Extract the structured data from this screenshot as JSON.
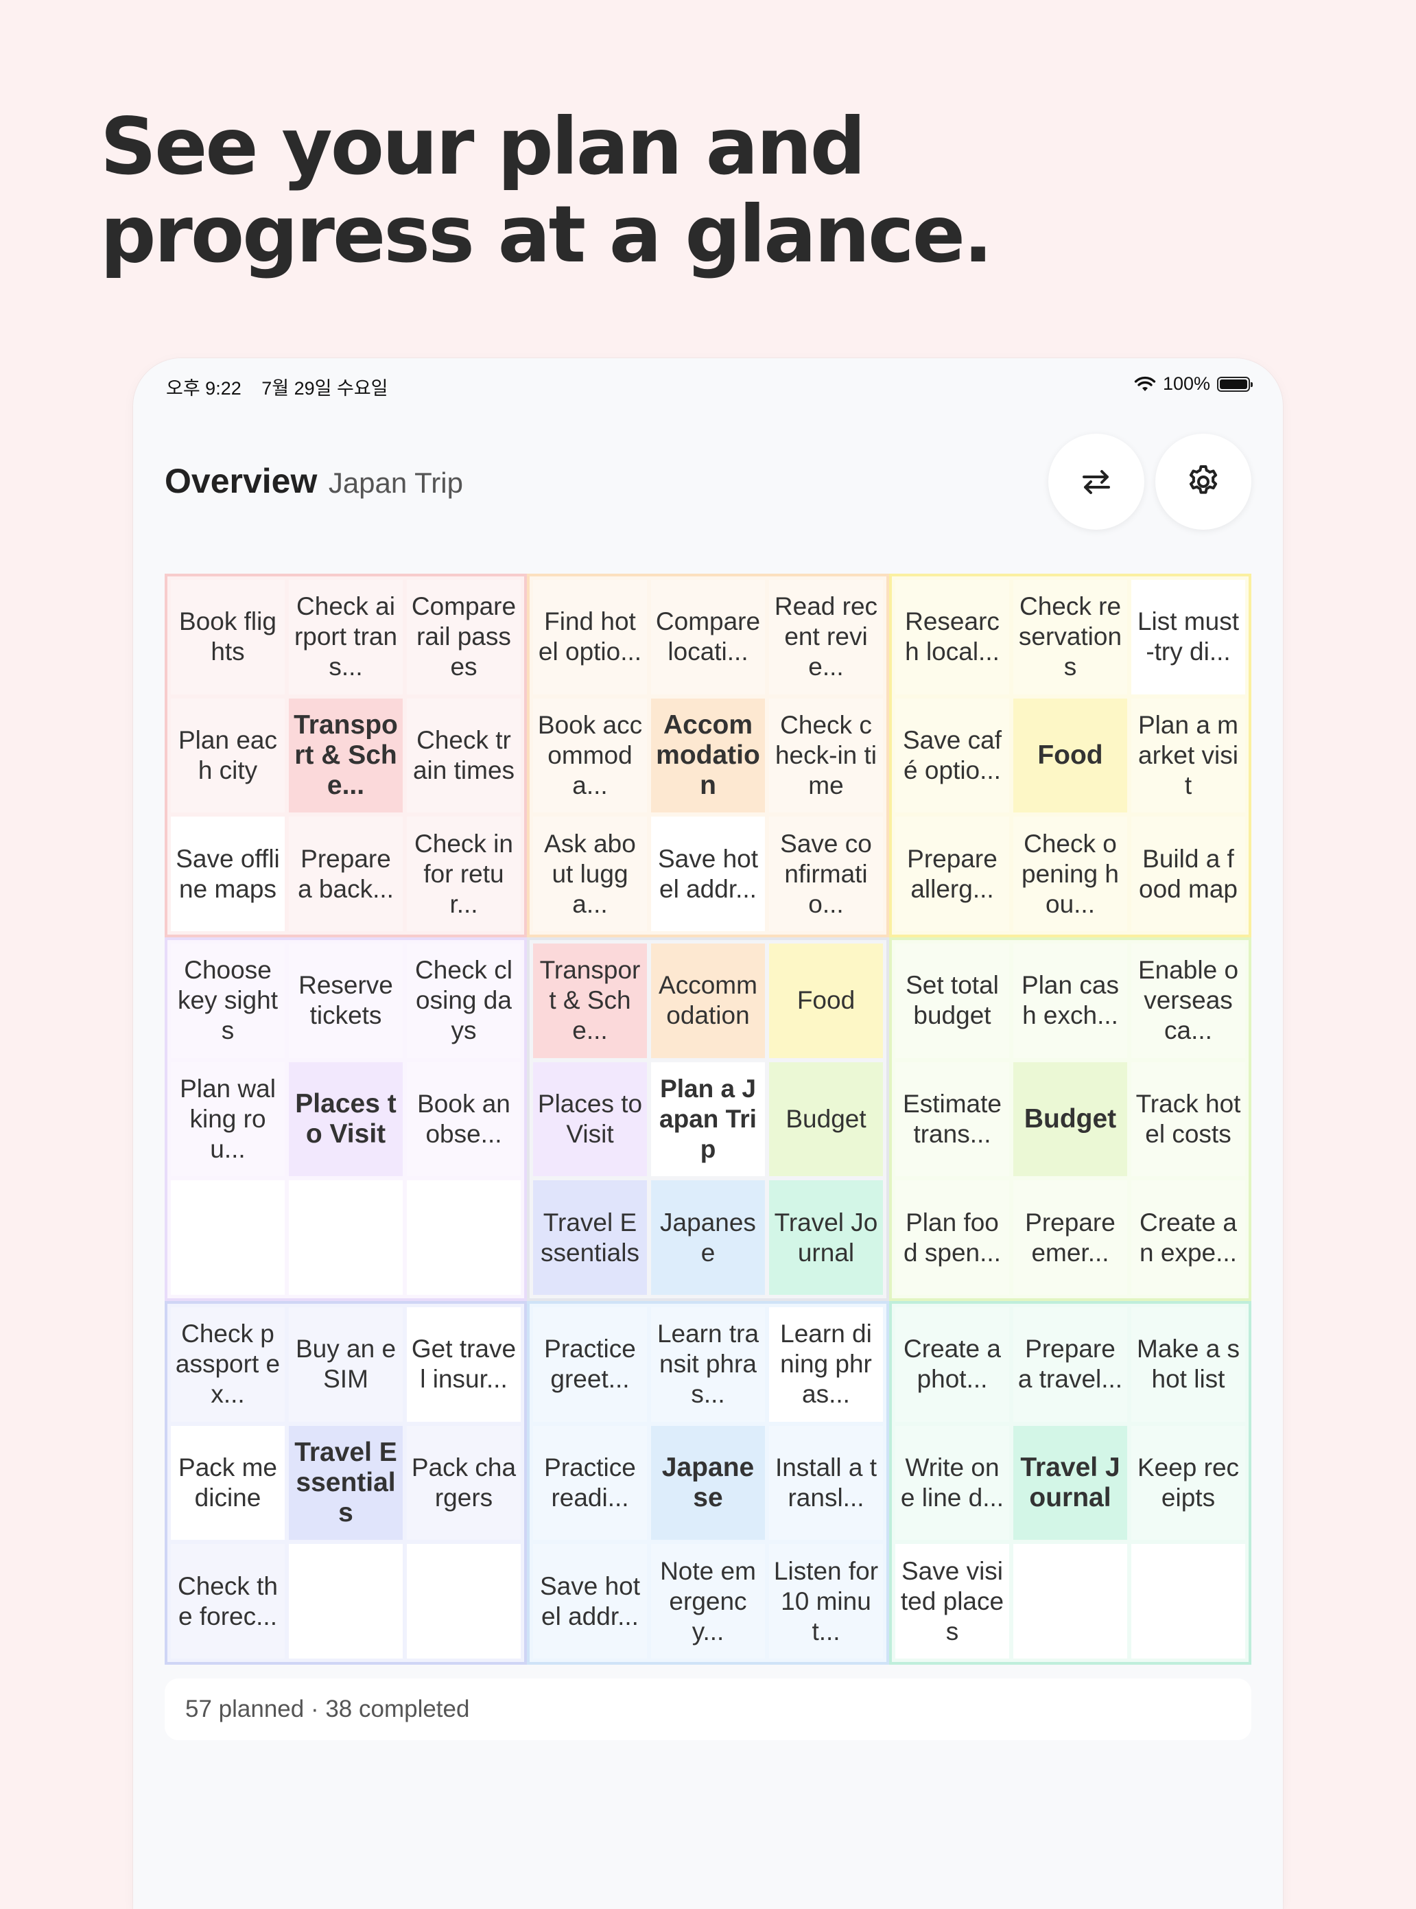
{
  "headline": [
    "See your plan and",
    "progress at a glance."
  ],
  "status": {
    "time": "오후 9:22",
    "date": "7월 29일 수요일",
    "battery": "100%"
  },
  "header": {
    "title": "Overview",
    "subtitle": "Japan Trip"
  },
  "palette": {
    "red": {
      "border": "#f7cccc",
      "cell": "#fdf0f0",
      "center": "#fbd9da",
      "text": "#333"
    },
    "orange": {
      "border": "#fce0bf",
      "cell": "#fef6ec",
      "center": "#fde8d1",
      "text": "#333"
    },
    "yellow": {
      "border": "#fbf0a0",
      "cell": "#fefbe6",
      "center": "#fdf7c6",
      "text": "#333"
    },
    "purple": {
      "border": "#e8dcfa",
      "cell": "#faf5fe",
      "center": "#f2e8fd",
      "text": "#333"
    },
    "lime": {
      "border": "#e2f5c2",
      "cell": "#f7fdee",
      "center": "#ebf8d5",
      "text": "#333"
    },
    "indigo": {
      "border": "#cfd5f5",
      "cell": "#f0f2fd",
      "center": "#e0e4fb",
      "text": "#333"
    },
    "sky": {
      "border": "#cfe3f7",
      "cell": "#eef6fe",
      "center": "#ddedfb",
      "text": "#333"
    },
    "mint": {
      "border": "#bfeedb",
      "cell": "#eefbf5",
      "center": "#d3f6e7",
      "text": "#333"
    }
  },
  "grid": [
    {
      "color": "red",
      "cells": [
        {
          "t": "Book flights"
        },
        {
          "t": "Check airport trans..."
        },
        {
          "t": "Compare rail passes"
        },
        {
          "t": "Plan each city"
        },
        {
          "t": "Transport & Sche...",
          "k": "center"
        },
        {
          "t": "Check train times"
        },
        {
          "t": "Save offline maps",
          "k": "white"
        },
        {
          "t": "Prepare a back..."
        },
        {
          "t": "Check in for retur..."
        }
      ]
    },
    {
      "color": "orange",
      "cells": [
        {
          "t": "Find hotel optio..."
        },
        {
          "t": "Compare locati..."
        },
        {
          "t": "Read recent revie..."
        },
        {
          "t": "Book accommoda..."
        },
        {
          "t": "Accommodation",
          "k": "center"
        },
        {
          "t": "Check check-in time"
        },
        {
          "t": "Ask about lugga..."
        },
        {
          "t": "Save hotel addr...",
          "k": "white"
        },
        {
          "t": "Save confirmatio..."
        }
      ]
    },
    {
      "color": "yellow",
      "cells": [
        {
          "t": "Research local..."
        },
        {
          "t": "Check reservations"
        },
        {
          "t": "List must-try di...",
          "k": "white"
        },
        {
          "t": "Save café optio..."
        },
        {
          "t": "Food",
          "k": "center"
        },
        {
          "t": "Plan a market visit"
        },
        {
          "t": "Prepare allerg..."
        },
        {
          "t": "Check opening hou..."
        },
        {
          "t": "Build a food map"
        }
      ]
    },
    {
      "color": "purple",
      "cells": [
        {
          "t": "Choose key sights"
        },
        {
          "t": "Reserve tickets"
        },
        {
          "t": "Check closing days"
        },
        {
          "t": "Plan walking rou..."
        },
        {
          "t": "Places to Visit",
          "k": "center"
        },
        {
          "t": "Book an obse..."
        },
        {
          "t": "",
          "k": "empty"
        },
        {
          "t": "",
          "k": "empty"
        },
        {
          "t": "",
          "k": "empty"
        }
      ]
    },
    {
      "color": "center",
      "cells": [
        {
          "t": "Transport & Sche...",
          "c": "red"
        },
        {
          "t": "Accommodation",
          "c": "orange"
        },
        {
          "t": "Food",
          "c": "yellow"
        },
        {
          "t": "Places to Visit",
          "c": "purple"
        },
        {
          "t": "Plan a Japan Trip",
          "k": "plan"
        },
        {
          "t": "Budget",
          "c": "lime"
        },
        {
          "t": "Travel Essentials",
          "c": "indigo"
        },
        {
          "t": "Japanese",
          "c": "sky"
        },
        {
          "t": "Travel Journal",
          "c": "mint"
        }
      ]
    },
    {
      "color": "lime",
      "cells": [
        {
          "t": "Set total budget"
        },
        {
          "t": "Plan cash exch..."
        },
        {
          "t": "Enable overseas ca..."
        },
        {
          "t": "Estimate trans..."
        },
        {
          "t": "Budget",
          "k": "center"
        },
        {
          "t": "Track hotel costs"
        },
        {
          "t": "Plan food spen..."
        },
        {
          "t": "Prepare emer..."
        },
        {
          "t": "Create an expe..."
        }
      ]
    },
    {
      "color": "indigo",
      "cells": [
        {
          "t": "Check passport ex..."
        },
        {
          "t": "Buy an eSIM"
        },
        {
          "t": "Get travel insur...",
          "k": "white"
        },
        {
          "t": "Pack medicine",
          "k": "white"
        },
        {
          "t": "Travel Essentials",
          "k": "center"
        },
        {
          "t": "Pack chargers"
        },
        {
          "t": "Check the forec..."
        },
        {
          "t": "",
          "k": "empty"
        },
        {
          "t": "",
          "k": "empty"
        }
      ]
    },
    {
      "color": "sky",
      "cells": [
        {
          "t": "Practice greet..."
        },
        {
          "t": "Learn transit phras..."
        },
        {
          "t": "Learn dining phras...",
          "k": "white"
        },
        {
          "t": "Practice readi..."
        },
        {
          "t": "Japanese",
          "k": "center"
        },
        {
          "t": "Install a transl..."
        },
        {
          "t": "Save hotel addr..."
        },
        {
          "t": "Note emergency..."
        },
        {
          "t": "Listen for 10 minut..."
        }
      ]
    },
    {
      "color": "mint",
      "cells": [
        {
          "t": "Create a phot..."
        },
        {
          "t": "Prepare a travel..."
        },
        {
          "t": "Make a shot list"
        },
        {
          "t": "Write one line d..."
        },
        {
          "t": "Travel Journal",
          "k": "center"
        },
        {
          "t": "Keep receipts"
        },
        {
          "t": "Save visited places",
          "k": "white"
        },
        {
          "t": "",
          "k": "empty"
        },
        {
          "t": "",
          "k": "empty"
        }
      ]
    }
  ],
  "summary": "57 planned · 38 completed"
}
